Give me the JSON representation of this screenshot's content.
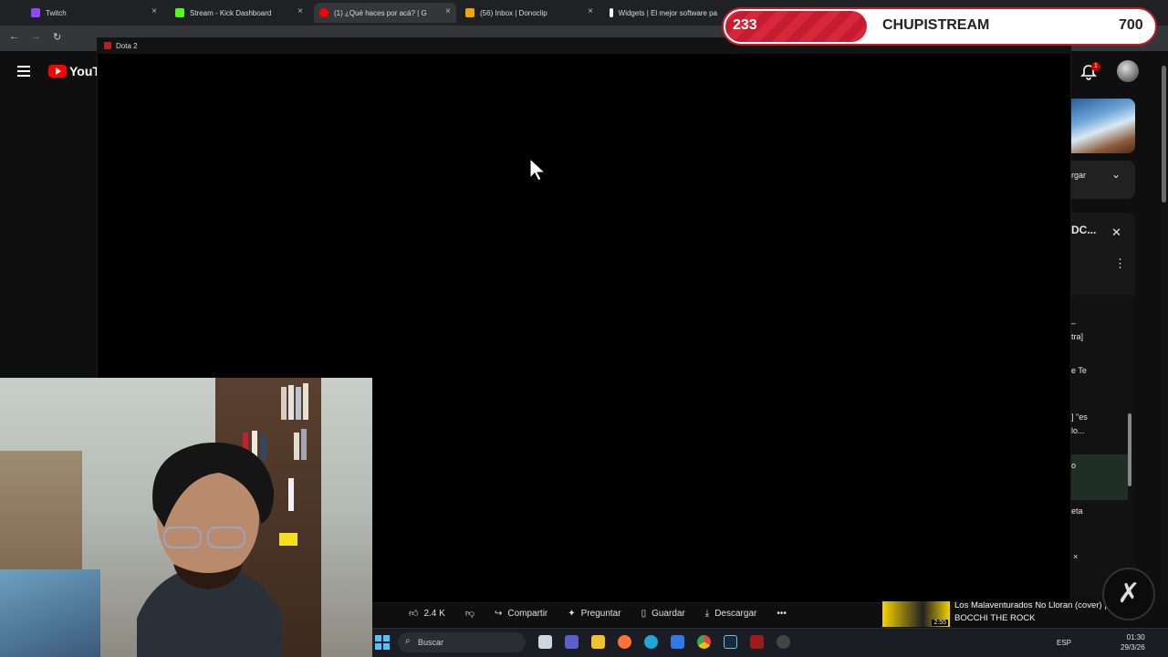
{
  "browser": {
    "tabs": [
      {
        "label": "Twitch",
        "color": "#9146ff"
      },
      {
        "label": "Stream - Kick Dashboard",
        "color": "#53fc18"
      },
      {
        "label": "(1) ¿Qué haces por acá? | G",
        "color": "#ff0000"
      },
      {
        "label": "(56) Inbox | Donoclip",
        "color": "#f4a300"
      },
      {
        "label": "Widgets | El mejor software pa",
        "color": "#ffffff"
      }
    ]
  },
  "game_window": {
    "title": "Dota 2"
  },
  "overlay": {
    "left_value": "233",
    "title": "CHUPISTREAM",
    "right_value": "700",
    "progress": 0.33
  },
  "youtube": {
    "logo": "YouTu",
    "notification_count": "1",
    "side": {
      "button_partial": "rgar",
      "title_partial": "DC...",
      "lines": [
        "–",
        "tra]",
        "e Te",
        "] \"es",
        "lo...",
        "o",
        "eta",
        "×"
      ]
    },
    "actions": {
      "likes": "2.4 K",
      "share": "Compartir",
      "ask": "Preguntar",
      "save": "Guardar",
      "download": "Descargar"
    },
    "next_video": {
      "title": "Los Malaventurados No Lloran (cover) | BOCCHI THE ROCK",
      "duration": "2:55"
    }
  },
  "taskbar": {
    "search_placeholder": "Buscar",
    "lang": "ESP",
    "time": "01:30",
    "date": "29/3/26"
  }
}
